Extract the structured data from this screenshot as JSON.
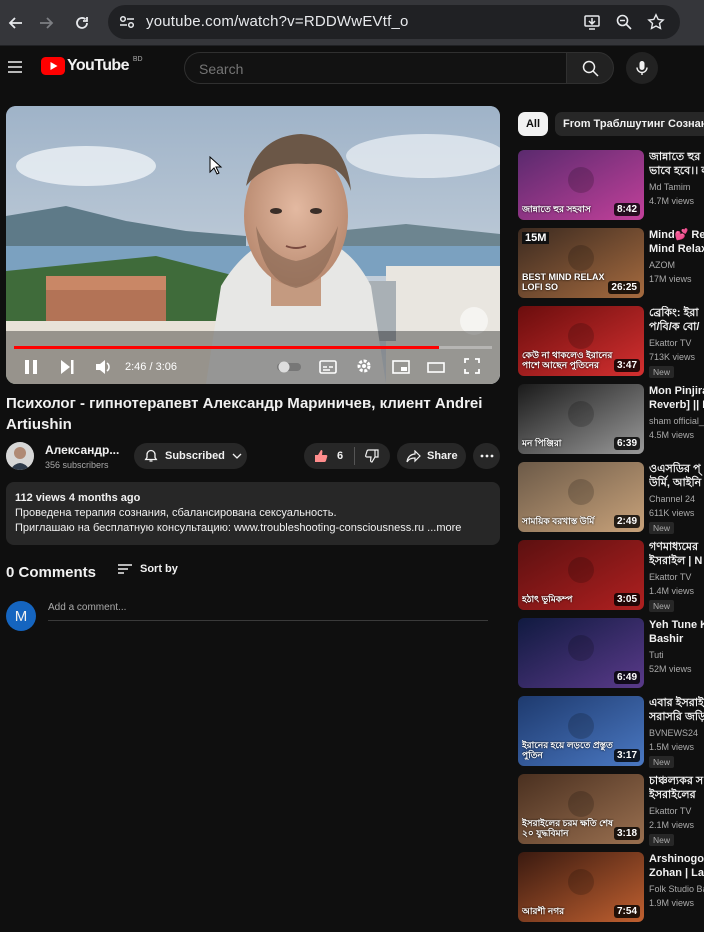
{
  "browser": {
    "url": "youtube.com/watch?v=RDDWwEVtf_o"
  },
  "header": {
    "logo_text": "YouTube",
    "country_code": "BD",
    "search_placeholder": "Search"
  },
  "player": {
    "time": "2:46 / 3:06",
    "progress": 0.89
  },
  "video": {
    "title": "Психолог - гипнотерапевт Александр Мариничев, клиент Andrei Artiushin",
    "channel_name": "Александр...",
    "subscribers": "356 subscribers",
    "subscribe_label": "Subscribed",
    "likes": "6",
    "share_label": "Share"
  },
  "description": {
    "stats": "112 views  4 months ago",
    "line1": "Проведена терапия сознания, сбалансирована сексуальность.",
    "line2": "Приглашаю на бесплатную консультацию: www.troubleshooting-consciousness.ru ...more"
  },
  "comments": {
    "count_label": "0 Comments",
    "sort_label": "Sort by",
    "avatar_letter": "M",
    "add_placeholder": "Add a comment..."
  },
  "chips": [
    "All",
    "From Траблшутинг Сознания"
  ],
  "recommendations": [
    {
      "title1": "জান্নাতে হুর",
      "title2": "ভাবে হবে।। ল",
      "channel": "Md Tamim",
      "views": "4.7M views",
      "duration": "8:42",
      "new": false,
      "thumb_text": "জান্নাতে হুর সহবাস",
      "colors": [
        "#5a2a6e",
        "#c2409a"
      ]
    },
    {
      "title1": "Mind💕 Relax",
      "title2": "Mind Relaxi",
      "channel": "AZOM",
      "views": "17M views",
      "duration": "26:25",
      "new": false,
      "thumb_text": "BEST MIND RELAX LOFI SO",
      "badge": "15M",
      "colors": [
        "#3b2a20",
        "#a66b3f"
      ]
    },
    {
      "title1": "ব্রেকিং: ইরা",
      "title2": "প/বি/ক বো/",
      "channel": "Ekattor TV",
      "views": "713K views",
      "duration": "3:47",
      "new": true,
      "thumb_text": "কেউ না থাকলেও ইরানের পাশে আছেন পুতিনের রাশিয়া",
      "colors": [
        "#6b0d0d",
        "#d43030"
      ]
    },
    {
      "title1": "Mon Pinjira",
      "title2": "Reverb] || Ra",
      "channel": "sham official_",
      "views": "4.5M views",
      "duration": "6:39",
      "new": false,
      "thumb_text": "মন পিঞ্জিরা",
      "colors": [
        "#1a1a1a",
        "#9a9a9a"
      ]
    },
    {
      "title1": "ওএসডির প্",
      "title2": "উর্মি, আইনি",
      "channel": "Channel 24",
      "views": "611K views",
      "duration": "2:49",
      "new": true,
      "thumb_text": "সাময়িক বরখাস্ত উর্মি",
      "colors": [
        "#6c5a48",
        "#c8a27a"
      ]
    },
    {
      "title1": "গণমাধ্যমের",
      "title2": "ইসরাইল | N",
      "channel": "Ekattor TV",
      "views": "1.4M views",
      "duration": "3:05",
      "new": true,
      "thumb_text": "হঠাৎ ভূমিকম্প",
      "colors": [
        "#5c1010",
        "#b02020"
      ]
    },
    {
      "title1": "Yeh Tune Ky",
      "title2": "Bashir",
      "channel": "Tuti",
      "views": "52M views",
      "duration": "6:49",
      "new": false,
      "thumb_text": "",
      "colors": [
        "#101a40",
        "#5a3a8a"
      ]
    },
    {
      "title1": "এবার ইসরাইল",
      "title2": "সরাসরি জড়ি",
      "channel": "BVNEWS24",
      "views": "1.5M views",
      "duration": "3:17",
      "new": true,
      "thumb_text": "ইরানের হয়ে লড়তে প্রস্তুত পুতিন",
      "colors": [
        "#1e3a6e",
        "#4a78c2"
      ]
    },
    {
      "title1": "চাঞ্চল্যকর স",
      "title2": "ইসরাইলের",
      "channel": "Ekattor TV",
      "views": "2.1M views",
      "duration": "3:18",
      "new": true,
      "thumb_text": "ইসরাইলের চরম ক্ষতি শেষ ২০ যুদ্ধবিমান",
      "colors": [
        "#4a3020",
        "#9a7050"
      ]
    },
    {
      "title1": "Arshinogor",
      "title2": "Zohan | Lalo",
      "channel": "Folk Studio Ba",
      "views": "1.9M views",
      "duration": "7:54",
      "new": false,
      "thumb_text": "আরশী নগর",
      "colors": [
        "#3a1a10",
        "#c06030"
      ]
    }
  ]
}
